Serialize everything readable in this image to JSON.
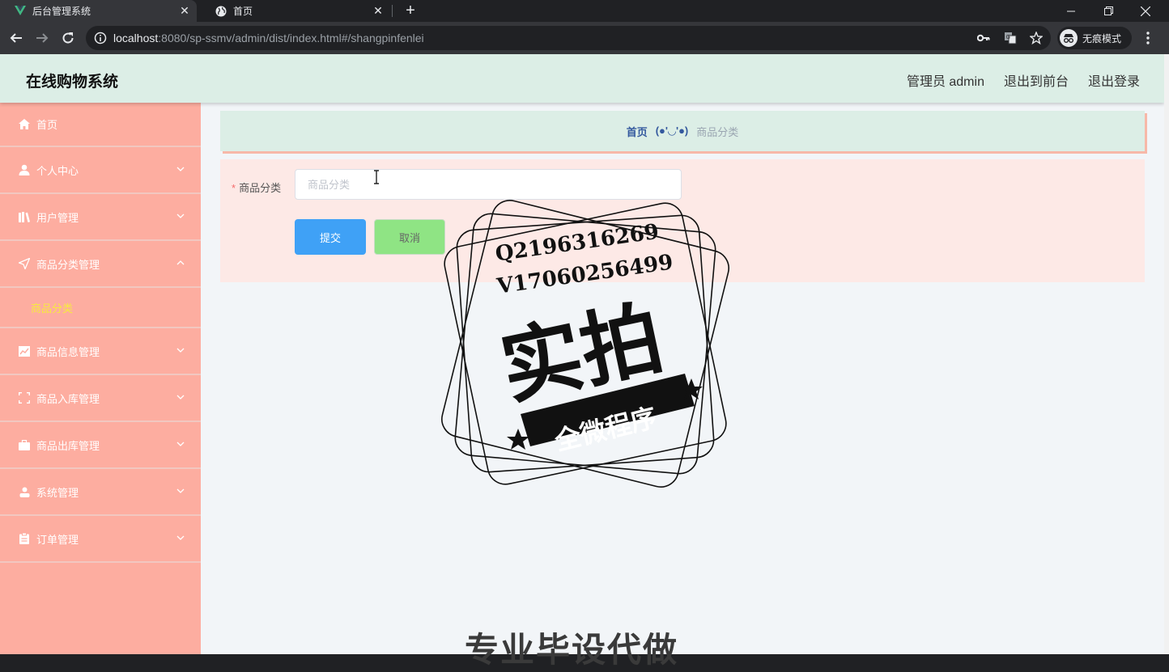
{
  "browser": {
    "tabs": [
      {
        "label": "后台管理系统",
        "active": true,
        "icon": "vue-logo-icon"
      },
      {
        "label": "首页",
        "active": false,
        "icon": "globe-icon"
      }
    ],
    "url_host": "localhost",
    "url_rest": ":8080/sp-ssmv/admin/dist/index.html#/shangpinfenlei",
    "incognito_label": "无痕模式"
  },
  "header": {
    "title": "在线购物系统",
    "admin_label": "管理员 admin",
    "to_front_label": "退出到前台",
    "logout_label": "退出登录"
  },
  "sidebar": {
    "items": [
      {
        "label": "首页",
        "icon": "home-icon",
        "arrow": "none"
      },
      {
        "label": "个人中心",
        "icon": "user-icon",
        "arrow": "down"
      },
      {
        "label": "用户管理",
        "icon": "books-icon",
        "arrow": "down"
      },
      {
        "label": "商品分类管理",
        "icon": "send-icon",
        "arrow": "up"
      },
      {
        "label": "商品分类",
        "icon": "",
        "arrow": "none",
        "sub": true
      },
      {
        "label": "商品信息管理",
        "icon": "chart-icon",
        "arrow": "down"
      },
      {
        "label": "商品入库管理",
        "icon": "scan-icon",
        "arrow": "down"
      },
      {
        "label": "商品出库管理",
        "icon": "briefcase-icon",
        "arrow": "down"
      },
      {
        "label": "系统管理",
        "icon": "person-icon",
        "arrow": "down"
      },
      {
        "label": "订单管理",
        "icon": "clipboard-icon",
        "arrow": "down"
      }
    ]
  },
  "breadcrumb": {
    "home": "首页",
    "separator": "(●'◡'●)",
    "current": "商品分类"
  },
  "form": {
    "label": "商品分类",
    "required_mark": "*",
    "input_value": "",
    "input_placeholder": "商品分类",
    "submit_label": "提交",
    "cancel_label": "取消"
  },
  "watermark": {
    "line1": "Q2196316269",
    "line2": "V17060256499",
    "main": "实拍",
    "banner": "全微程序",
    "bottom": "专业毕设代做"
  },
  "colors": {
    "header_bg": "#dceee6",
    "sidebar_bg": "#fdada0",
    "submenu_active": "#f7ea3f",
    "submit_bg": "#3fa1f6",
    "cancel_bg": "#8fe484",
    "form_bg": "#fde9e6"
  }
}
